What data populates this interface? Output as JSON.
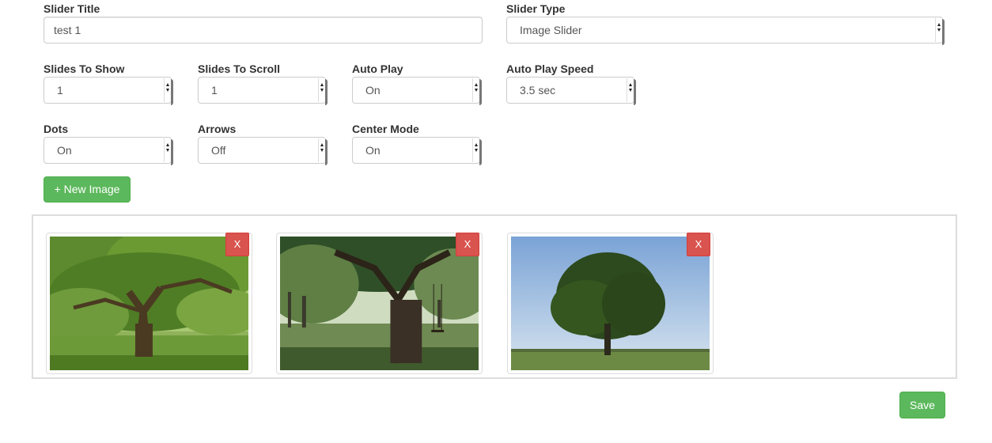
{
  "form": {
    "slider_title": {
      "label": "Slider Title",
      "value": "test 1"
    },
    "slider_type": {
      "label": "Slider Type",
      "value": "Image Slider"
    },
    "slides_to_show": {
      "label": "Slides To Show",
      "value": "1"
    },
    "slides_to_scroll": {
      "label": "Slides To Scroll",
      "value": "1"
    },
    "auto_play": {
      "label": "Auto Play",
      "value": "On"
    },
    "auto_play_speed": {
      "label": "Auto Play Speed",
      "value": "3.5 sec"
    },
    "dots": {
      "label": "Dots",
      "value": "On"
    },
    "arrows": {
      "label": "Arrows",
      "value": "Off"
    },
    "center_mode": {
      "label": "Center Mode",
      "value": "On"
    }
  },
  "new_image_button": "+ New Image",
  "images": [
    {
      "remove_label": "X",
      "subject": "large spreading oak tree"
    },
    {
      "remove_label": "X",
      "subject": "tree trunk with rope swing"
    },
    {
      "remove_label": "X",
      "subject": "lone tree in field under blue sky"
    }
  ],
  "save_button": "Save",
  "colors": {
    "success": "#5cb85c",
    "danger": "#d9534f",
    "border": "#cccccc"
  }
}
